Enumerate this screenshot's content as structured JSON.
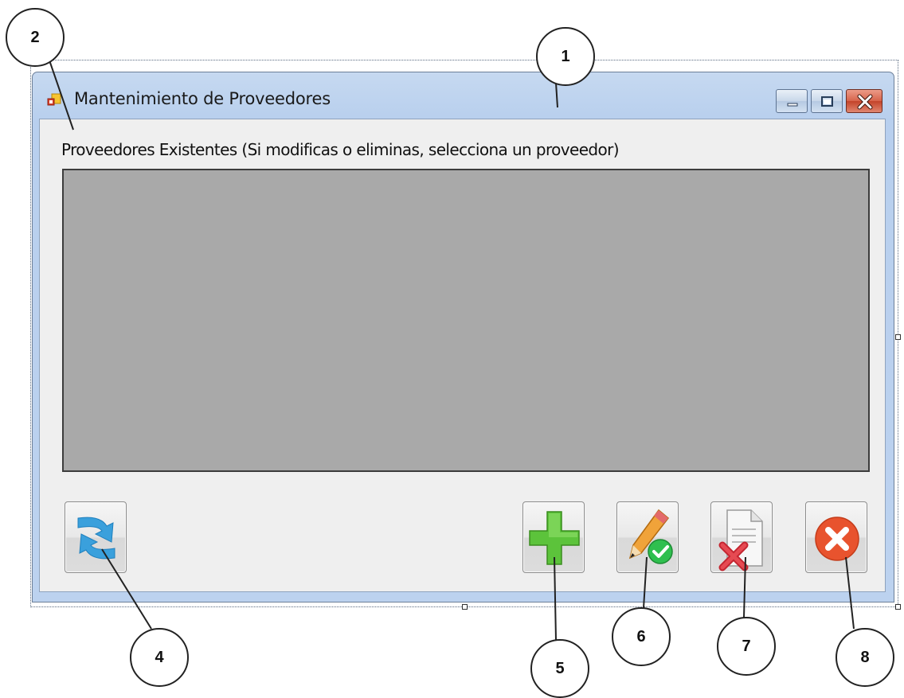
{
  "window": {
    "title": "Mantenimiento de Proveedores",
    "icon": "app-form-icon",
    "caption_buttons": [
      "minimize-icon",
      "maximize-icon",
      "close-icon"
    ]
  },
  "main": {
    "label": "Proveedores Existentes (Si modificas o eliminas, selecciona un proveedor)",
    "grid_color": "#a9a9a9"
  },
  "buttons": [
    {
      "id": "refresh",
      "icon": "refresh-arrows-icon"
    },
    {
      "id": "add",
      "icon": "plus-icon"
    },
    {
      "id": "edit",
      "icon": "pencil-check-icon"
    },
    {
      "id": "delete",
      "icon": "document-x-icon"
    },
    {
      "id": "close",
      "icon": "close-circle-icon"
    }
  ],
  "callouts": [
    "1",
    "2",
    "4",
    "5",
    "6",
    "7",
    "8"
  ]
}
